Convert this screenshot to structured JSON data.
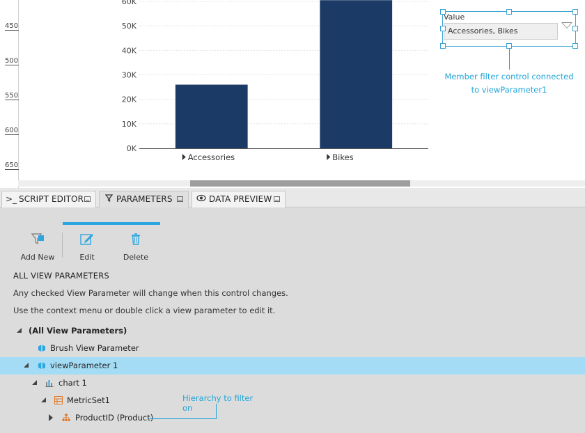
{
  "ruler": {
    "labels": [
      "450",
      "500",
      "550",
      "600",
      "650"
    ]
  },
  "chart_data": {
    "type": "bar",
    "categories": [
      "Accessories",
      "Bikes"
    ],
    "values": [
      26000,
      60500
    ],
    "ylim": [
      0,
      60000
    ],
    "yticks": [
      "0K",
      "10K",
      "20K",
      "30K",
      "40K",
      "50K",
      "60K"
    ],
    "grid": true,
    "bar_color": "#1b3a66"
  },
  "filter": {
    "caption": "Value",
    "selected_value": "Accessories, Bikes",
    "annotation_line1": "Member filter control connected",
    "annotation_line2": "to viewParameter1"
  },
  "tabs": [
    {
      "label": "SCRIPT EDITOR",
      "icon": "terminal-icon"
    },
    {
      "label": "PARAMETERS",
      "icon": "filter-icon"
    },
    {
      "label": "DATA PREVIEW",
      "icon": "eye-icon"
    }
  ],
  "toolbar": {
    "add_new": "Add New",
    "edit": "Edit",
    "delete": "Delete"
  },
  "section": {
    "title": "ALL VIEW PARAMETERS",
    "desc1": "Any checked View Parameter will change when this control changes.",
    "desc2": "Use the context menu or double click a view parameter to edit it."
  },
  "tree": {
    "root": "(All View Parameters)",
    "brush": "Brush View Parameter",
    "view_param": "viewParameter 1",
    "chart": "chart 1",
    "metricset": "MetricSet1",
    "productid": "ProductID (Product)"
  },
  "hierarchy_annotation": "Hierarchy to filter on",
  "colors": {
    "accent": "#2ca6e0",
    "selected_row": "#a4dcf6",
    "annotation": "#22a5d8"
  }
}
